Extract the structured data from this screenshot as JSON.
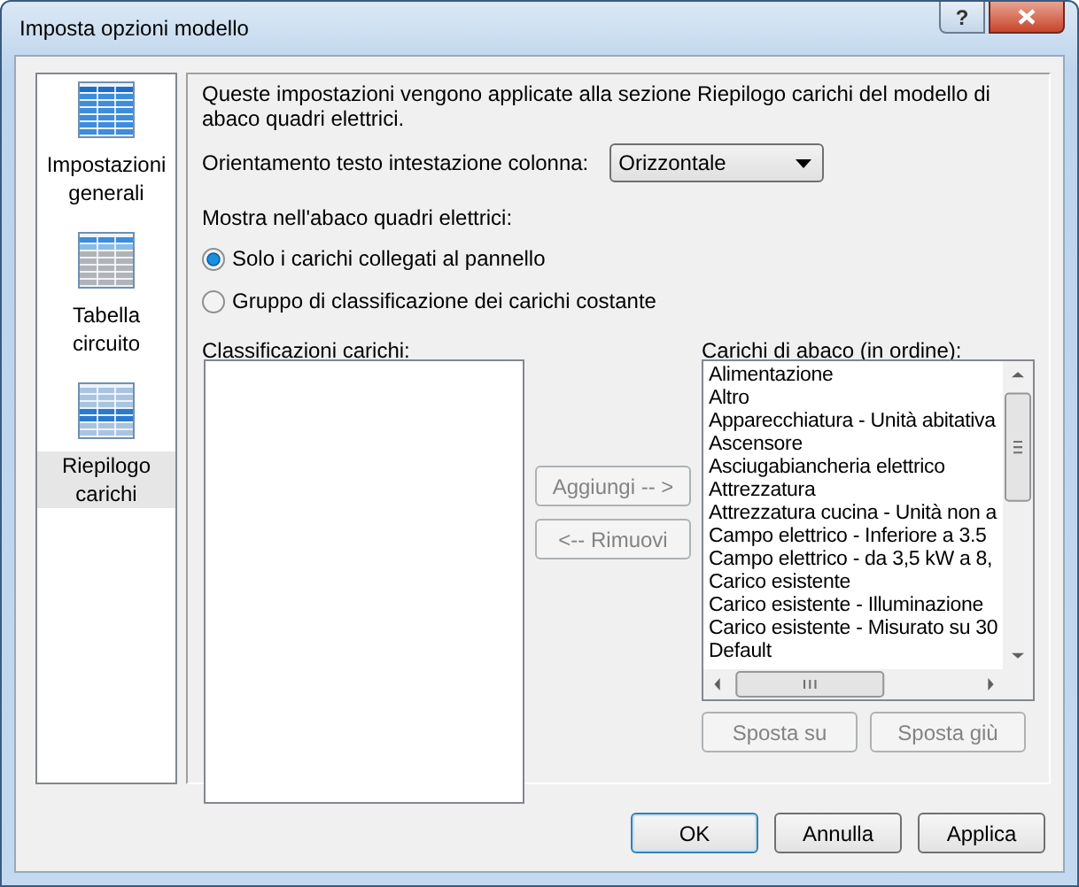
{
  "window": {
    "title": "Imposta opzioni modello",
    "help_button": "?"
  },
  "sidebar": {
    "items": [
      {
        "kind": "general",
        "label": "Impostazioni generali",
        "selected": false
      },
      {
        "kind": "circuit",
        "label": "Tabella circuito",
        "selected": false
      },
      {
        "kind": "summary",
        "label": "Riepilogo carichi",
        "selected": true
      }
    ]
  },
  "content": {
    "description": "Queste impostazioni vengono applicate alla sezione Riepilogo carichi del modello di abaco quadri elettrici.",
    "orientation": {
      "label": "Orientamento testo intestazione colonna:",
      "value": "Orizzontale"
    },
    "show_label": "Mostra nell'abaco quadri elettrici:",
    "radios": [
      {
        "label": "Solo i carichi collegati al pannello",
        "selected": true
      },
      {
        "label": "Gruppo di classificazione dei carichi costante",
        "selected": false
      }
    ],
    "classifications": {
      "label": "Classificazioni carichi:"
    },
    "add_button": {
      "label": "Aggiungi -- >",
      "disabled": true
    },
    "remove_button": {
      "label": "<-- Rimuovi",
      "disabled": true
    },
    "loads": {
      "label": "Carichi di abaco (in ordine):",
      "items": [
        "Alimentazione",
        "Altro",
        "Apparecchiatura - Unità abitativa",
        "Ascensore",
        "Asciugabiancheria elettrico",
        "Attrezzatura",
        "Attrezzatura cucina - Unità non a",
        "Campo elettrico - Inferiore a 3.5",
        "Campo elettrico - da 3,5 kW a 8,",
        "Carico esistente",
        "Carico esistente - Illuminazione",
        "Carico esistente - Misurato su 30",
        "Default"
      ]
    },
    "move_buttons": [
      {
        "label": "Sposta su",
        "disabled": true
      },
      {
        "label": "Sposta giù",
        "disabled": true
      }
    ]
  },
  "footer_buttons": [
    {
      "label": "OK",
      "default": true
    },
    {
      "label": "Annulla",
      "default": false
    },
    {
      "label": "Applica",
      "default": false
    }
  ]
}
